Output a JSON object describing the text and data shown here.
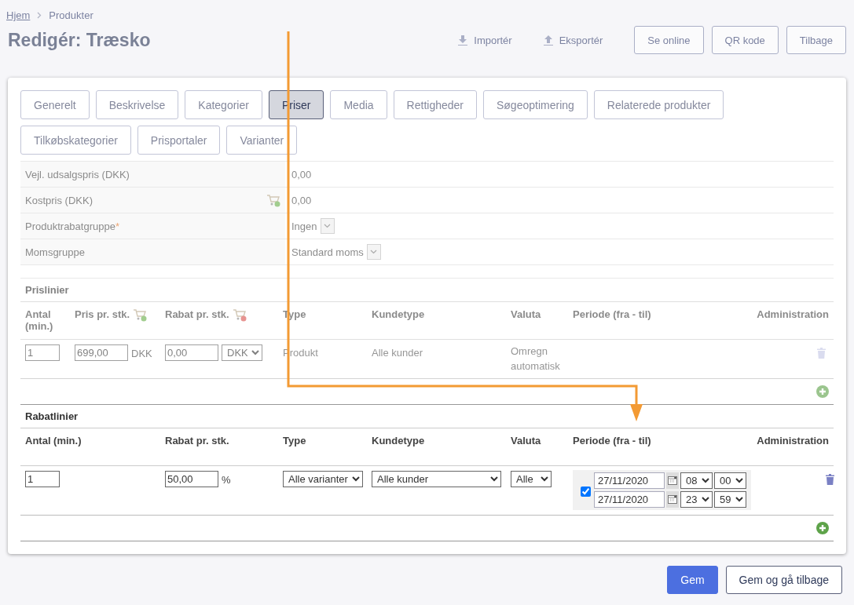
{
  "breadcrumb": {
    "dimmed": true,
    "items": [
      {
        "label": "Hjem",
        "kind": "link"
      },
      {
        "label": "Produkter",
        "kind": "current"
      }
    ]
  },
  "header": {
    "dimmed": true,
    "title": "Redigér: Træsko",
    "actions": [
      {
        "label": "Importér",
        "kind": "import"
      },
      {
        "label": "Eksportér",
        "kind": "export"
      },
      {
        "label": "Se online",
        "kind": "button"
      },
      {
        "label": "QR kode",
        "kind": "button"
      },
      {
        "label": "Tilbage",
        "kind": "button"
      }
    ]
  },
  "tabs": {
    "dimmed": true,
    "items": [
      {
        "label": "Generelt",
        "selected": false
      },
      {
        "label": "Beskrivelse",
        "selected": false
      },
      {
        "label": "Kategorier",
        "selected": false
      },
      {
        "label": "Priser",
        "selected": true
      },
      {
        "label": "Media",
        "selected": false
      },
      {
        "label": "Rettigheder",
        "selected": false
      },
      {
        "label": "Søgeoptimering",
        "selected": false
      },
      {
        "label": "Relaterede produkter",
        "selected": false
      },
      {
        "label": "Tilkøbskategorier",
        "selected": false
      },
      {
        "label": "Prisportaler",
        "selected": false
      },
      {
        "label": "Varianter",
        "selected": false
      }
    ]
  },
  "fields": {
    "dimmed": true,
    "rows": [
      {
        "label": "Vejl. udsalgspris (DKK)",
        "value": "0,00",
        "kind": "text"
      },
      {
        "label": "Kostpris (DKK)",
        "value": "0,00",
        "kind": "text_cart"
      },
      {
        "label": "Produktrabatgruppe",
        "required_mark": "*",
        "value": "Ingen",
        "kind": "select"
      },
      {
        "label": "Momsgruppe",
        "value": "Standard moms",
        "kind": "select"
      }
    ]
  },
  "price_lines": {
    "dimmed": true,
    "title": "Prislinier",
    "columns": [
      {
        "label": "Antal (min.)",
        "kind": "quantity"
      },
      {
        "label": "Pris pr. stk.",
        "kind": "price_cart"
      },
      {
        "label": "Rabat pr. stk.",
        "kind": "discount_cart"
      },
      {
        "label": "Type",
        "kind": "type"
      },
      {
        "label": "Kundetype",
        "kind": "customer"
      },
      {
        "label": "Valuta",
        "kind": "currency"
      },
      {
        "label": "Periode (fra - til)",
        "kind": "period"
      },
      {
        "label": "Administration",
        "kind": "admin"
      }
    ],
    "rows": [
      {
        "quantity": "1",
        "price": "699,00",
        "price_currency": "DKK",
        "discount": "0,00",
        "discount_currency": "DKK",
        "type": "Produkt",
        "customer_type": "Alle kunder",
        "currency": "Omregn automatisk"
      }
    ]
  },
  "discount_lines": {
    "dimmed": false,
    "title": "Rabatlinier",
    "columns": [
      {
        "label": "Antal (min.)",
        "kind": "quantity"
      },
      {
        "label": "Rabat pr. stk.",
        "kind": "discount"
      },
      {
        "label": "Type",
        "kind": "type"
      },
      {
        "label": "Kundetype",
        "kind": "customer"
      },
      {
        "label": "Valuta",
        "kind": "currency"
      },
      {
        "label": "Periode (fra - til)",
        "kind": "period"
      },
      {
        "label": "Administration",
        "kind": "admin"
      }
    ],
    "rows": [
      {
        "quantity": "1",
        "discount": "50,00",
        "unit": "%",
        "type": "Alle varianter",
        "customer_type": "Alle kunder",
        "currency": "Alle",
        "period": {
          "enabled": true,
          "from_date": "27/11/2020",
          "from_hour": "08",
          "from_minute": "00",
          "to_date": "27/11/2020",
          "to_hour": "23",
          "to_minute": "59"
        }
      }
    ]
  },
  "footer_buttons": [
    {
      "label": "Gem",
      "kind": "primary"
    },
    {
      "label": "Gem og gå tilbage",
      "kind": "secondary"
    }
  ]
}
